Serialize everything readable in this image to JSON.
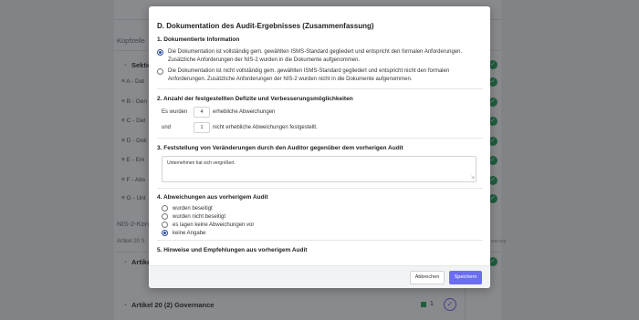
{
  "background": {
    "kopfzeile": "Kopfzeile",
    "section_label": "Sektio",
    "items": [
      "A - Dat",
      "B - Gen",
      "C - Dat",
      "D - Dok",
      "E - Erk",
      "F - Abs",
      "G - Unt"
    ],
    "nis2_konf": "NIS-2-Konf",
    "artikel_20_text": "Artikel 20 S",
    "artikel_collapsed": "Artikel",
    "artikel_governance": "Artikel 20 (2) Governance",
    "governance_count": "1",
    "right_hint": "werung"
  },
  "modal": {
    "title": "D. Dokumentation des Audit-Ergebnisses (Zusammenfassung)",
    "section1": {
      "title": "1. Dokumentierte Information",
      "options": [
        {
          "label": "Die Dokumentation ist vollständig gem. gewählten ISMS-Standard gegliedert und entspricht den formalen Anforderungen. Zusätzliche Anforderungen der NIS-2 wurden in die Dokumente aufgenommen.",
          "checked": true
        },
        {
          "label": "Die Dokumentation ist nicht vollständig gem. gewählten ISMS-Standard gegliedert und entspricht nicht den formalen Anforderungen. Zusätzliche Anforderungen der NIS-2 wurden nicht in die Dokumente aufgenommen.",
          "checked": false
        }
      ]
    },
    "section2": {
      "title": "2. Anzahl der festgestellten Defizite und Verbesserungsmöglichkeiten",
      "row1_prefix": "Es wurden",
      "row1_value": "4",
      "row1_suffix": "erhebliche Abweichungen",
      "row2_prefix": "und",
      "row2_value": "1",
      "row2_suffix": "nicht erhebliche Abweichungen festgestellt."
    },
    "section3": {
      "title": "3. Feststellung von Veränderungen durch den Auditor gegenüber dem vorherigen Audit",
      "text": "Unternehmen hat sich vergrößert."
    },
    "section4": {
      "title": "4. Abweichungen aus vorherigem Audit",
      "options": [
        {
          "label": "wurden beseitigt",
          "checked": false
        },
        {
          "label": "wurden nicht beseitigt",
          "checked": false
        },
        {
          "label": "es lagen keine Abweichungen vor",
          "checked": false
        },
        {
          "label": "keine Angabe",
          "checked": true
        }
      ]
    },
    "section5": {
      "title": "5. Hinweise und Empfehlungen aus vorherigem Audit"
    },
    "footer": {
      "cancel_label": "Abbrechen",
      "save_label": "Speichern"
    }
  },
  "colors": {
    "accent": "#6b6ef0",
    "radio_checked": "#2b4aa6",
    "success": "#2aa65e"
  }
}
